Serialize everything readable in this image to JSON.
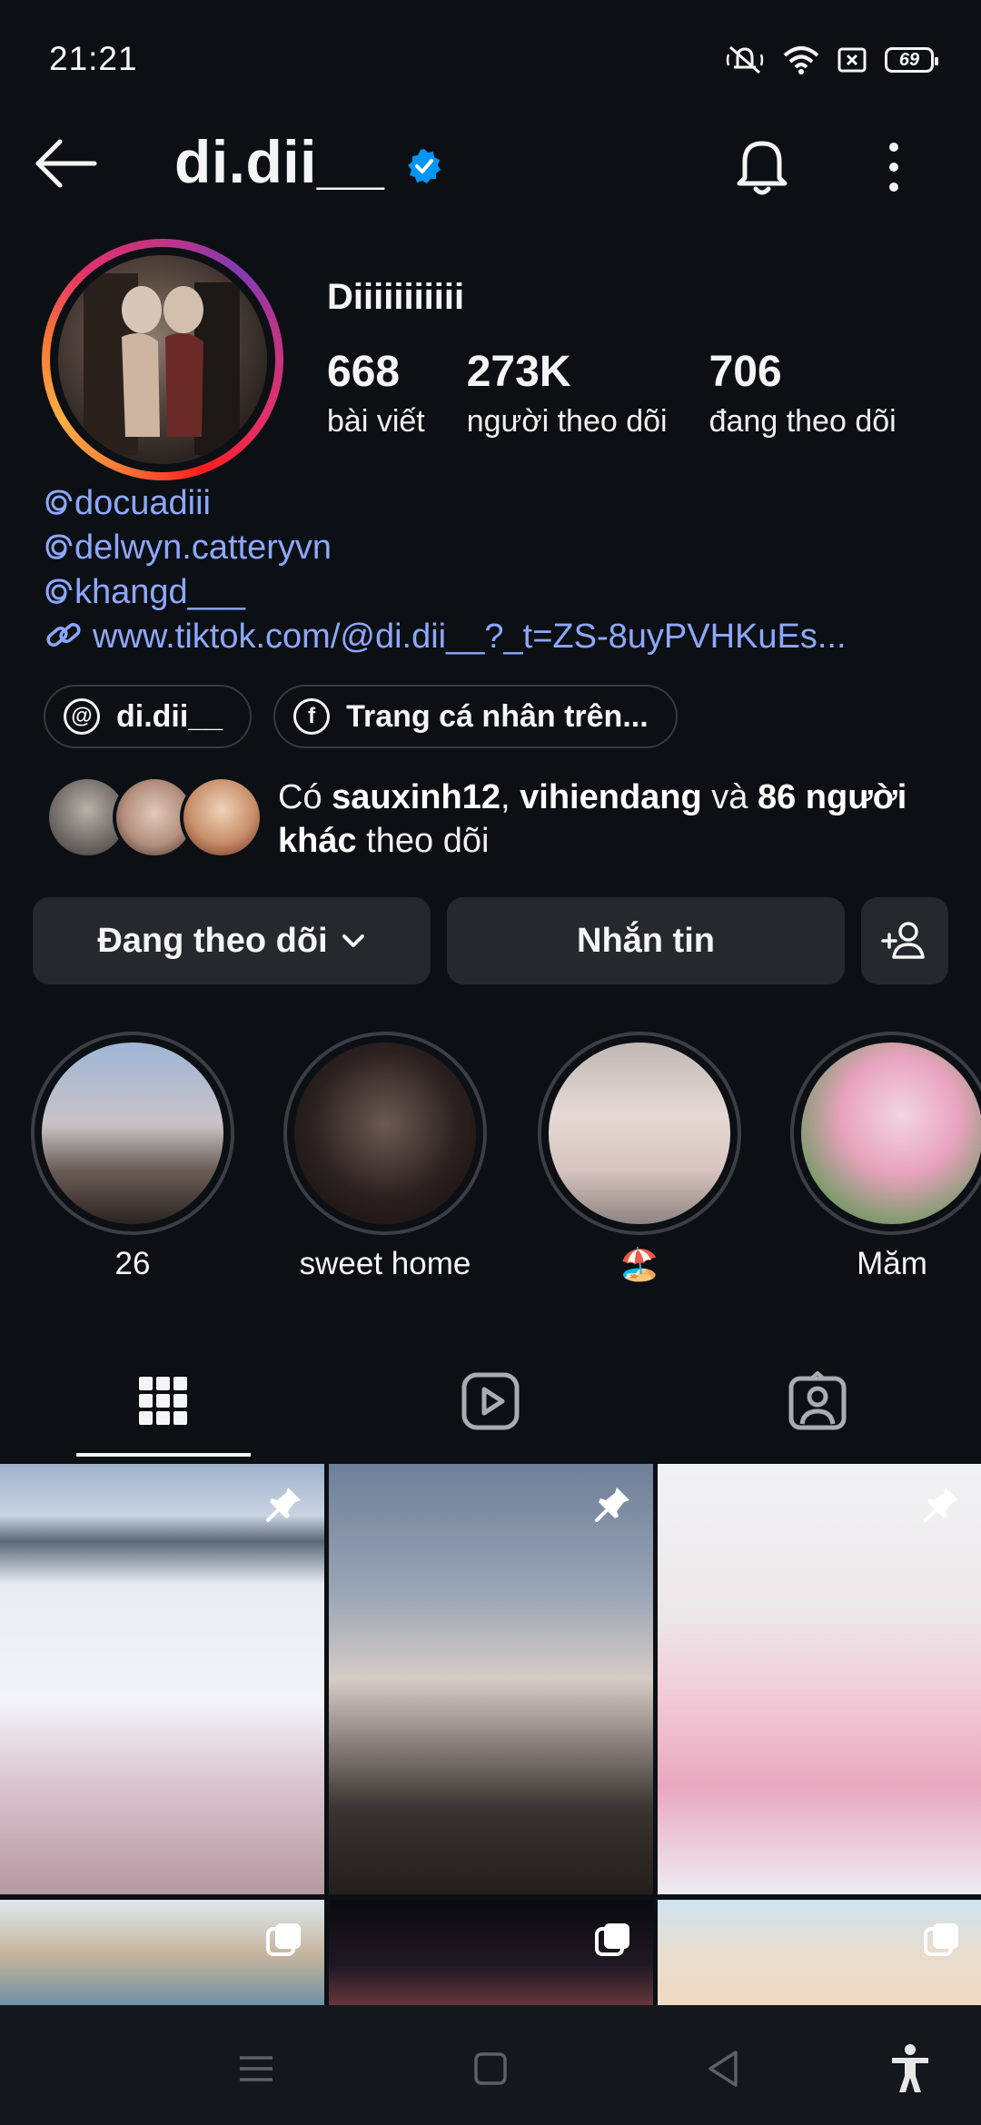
{
  "status": {
    "time": "21:21",
    "battery": "69"
  },
  "header": {
    "username": "di.dii__"
  },
  "profile": {
    "display_name": "Diiiiiiiiiii",
    "stats": [
      {
        "value": "668",
        "label": "bài viết"
      },
      {
        "value": "273K",
        "label": "người theo dõi"
      },
      {
        "value": "706",
        "label": "đang theo dõi"
      }
    ],
    "links": [
      "docuadiii",
      "delwyn.catteryvn",
      "khangd___"
    ],
    "url": "www.tiktok.com/@di.dii__?_t=ZS-8uyPVHKuEs..."
  },
  "chips": [
    {
      "icon": "threads-icon",
      "label": "di.dii__"
    },
    {
      "icon": "facebook-icon",
      "label": "Trang cá nhân trên..."
    }
  ],
  "followed_by": {
    "prefix": "Có ",
    "user1": "sauxinh12",
    "sep": ", ",
    "user2": "vihiendang",
    "and": " và ",
    "others": "86 người khác",
    "suffix": " theo dõi"
  },
  "actions": {
    "following": "Đang theo dõi",
    "message": "Nhắn tin"
  },
  "highlights": [
    {
      "label": "26"
    },
    {
      "label": "sweet home"
    },
    {
      "label": "🏖️"
    },
    {
      "label": "Măm"
    }
  ],
  "tabs": [
    "grid-icon",
    "reels-icon",
    "tagged-icon"
  ],
  "colors": {
    "background": "#0c1014",
    "link": "#8ea7ff",
    "verified": "#0095f6",
    "button": "#25292e"
  }
}
